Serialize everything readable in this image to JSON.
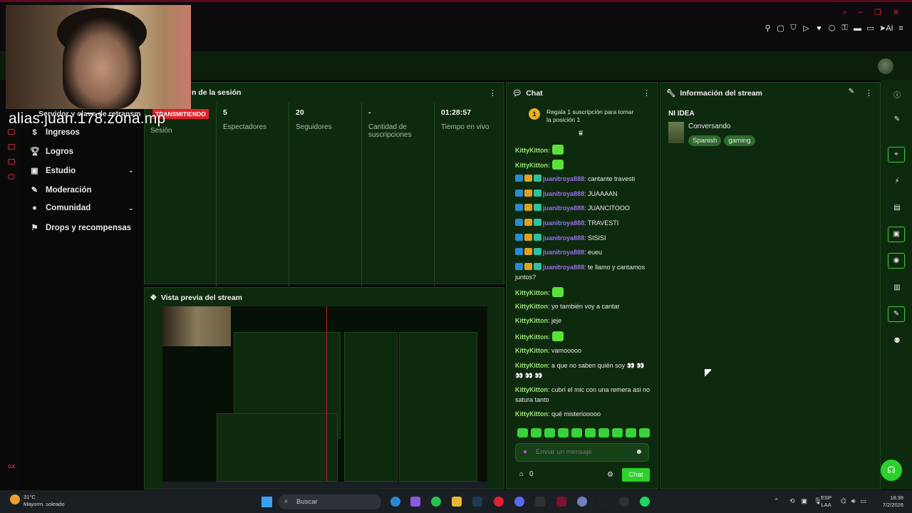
{
  "overlay": {
    "cam_caption": "alias.juan.178.zona.mp",
    "server_key_label": "Servidor y clave de retransm",
    "live_badge": "TRANSMITIENDO"
  },
  "sidebar": {
    "items": [
      {
        "label": "Ingresos",
        "icon": "money-icon"
      },
      {
        "label": "Logros",
        "icon": "trophy-icon"
      },
      {
        "label": "Estudio",
        "icon": "studio-icon"
      },
      {
        "label": "Moderación",
        "icon": "wrench-icon"
      },
      {
        "label": "Comunidad",
        "icon": "community-icon"
      },
      {
        "label": "Drops y recompensas",
        "icon": "gift-icon"
      }
    ]
  },
  "session": {
    "title": "n de la sesión",
    "session_label": "Sesión",
    "stats": [
      {
        "value": "5",
        "label": "Espectadores"
      },
      {
        "value": "20",
        "label": "Seguidores"
      },
      {
        "value": "-",
        "label": "Cantidad de suscripciones"
      },
      {
        "value": "01:28:57",
        "label": "Tiempo en vivo"
      }
    ]
  },
  "preview": {
    "title": "Vista previa del stream"
  },
  "chat": {
    "title": "Chat",
    "pinned_rank": "1",
    "pinned_text": "Regala 1 suscripción para tomar la posición 1",
    "messages": [
      {
        "user": "KittyKitton",
        "text": "",
        "type": "bot",
        "emote": true
      },
      {
        "user": "KittyKitton",
        "text": "",
        "type": "bot",
        "emote": true
      },
      {
        "user": "juanitroya888",
        "text": ": cantante travesti",
        "type": "owner"
      },
      {
        "user": "juanitroya888",
        "text": ": JUAAAAN",
        "type": "owner"
      },
      {
        "user": "juanitroya888",
        "text": ": JUANCITOOO",
        "type": "owner"
      },
      {
        "user": "juanitroya888",
        "text": ": TRAVESTI",
        "type": "owner"
      },
      {
        "user": "juanitroya888",
        "text": ": SISISI",
        "type": "owner"
      },
      {
        "user": "juanitroya888",
        "text": ": eueu",
        "type": "owner"
      },
      {
        "user": "juanitroya888",
        "text": ": te llamo y cantamos juntos?",
        "type": "owner"
      },
      {
        "user": "KittyKitton",
        "text": "",
        "type": "bot",
        "emote": true
      },
      {
        "user": "KittyKitton",
        "text": ": yo también voy a cantar",
        "type": "bot"
      },
      {
        "user": "KittyKitton",
        "text": ": jeje",
        "type": "bot"
      },
      {
        "user": "KittyKitton",
        "text": "",
        "type": "bot",
        "emote": true
      },
      {
        "user": "KittyKitton",
        "text": ": vamooooo",
        "type": "bot"
      },
      {
        "user": "KittyKitton",
        "text": ": a que no saben quién soy 👀 👀 👀 👀 👀",
        "type": "bot"
      },
      {
        "user": "KittyKitton",
        "text": ": cubrí el mic con una remera asi no satura tanto",
        "type": "bot"
      },
      {
        "user": "KittyKitton",
        "text": ": qué misteriooooo",
        "type": "bot"
      }
    ],
    "input_placeholder": "Enviar un mensaje",
    "points": "0",
    "send_label": "Chat"
  },
  "stream_info": {
    "title": "Información del stream",
    "stream_title": "NI IDEA",
    "category": "Conversando",
    "tags": [
      "Spanish",
      "gaming"
    ]
  },
  "taskbar": {
    "weather_temp": "31°C",
    "weather_desc": "Mayorm. soleado",
    "search_placeholder": "Buscar",
    "lang_top": "ESP",
    "lang_bottom": "LAA",
    "time": "18:38",
    "date": "7/2/2026"
  },
  "colors": {
    "accent": "#2ad22a",
    "panel": "#0e2a0e",
    "live": "#e0202a",
    "owner_name": "#9a6cf0",
    "bot_name": "#9be27a"
  }
}
